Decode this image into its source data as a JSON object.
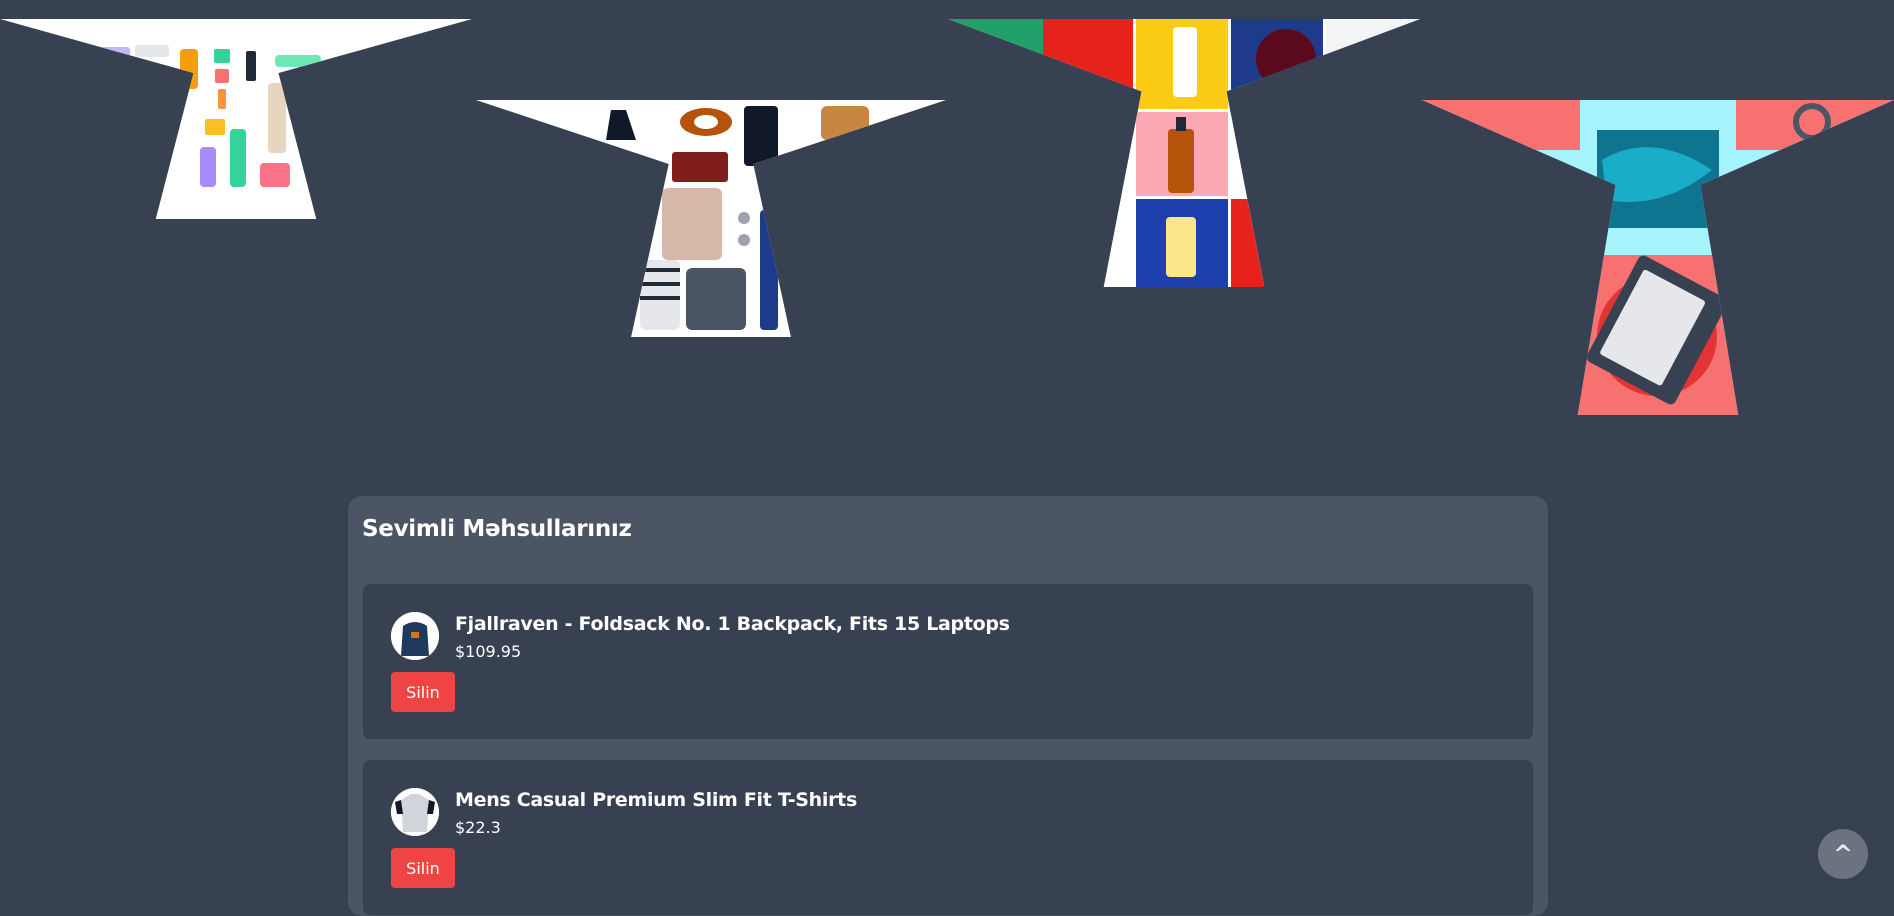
{
  "banners": [
    {
      "name": "cosmetics",
      "accent": "#f97316"
    },
    {
      "name": "fashion",
      "accent": "#7f1d1d"
    },
    {
      "name": "skincare",
      "accent": "#e5231b"
    },
    {
      "name": "electronics",
      "accent": "#f87171"
    }
  ],
  "favorites": {
    "heading": "Sevimli Məhsullarınız",
    "items": [
      {
        "title": "Fjallraven - Foldsack No. 1 Backpack, Fits 15 Laptops",
        "price": "$109.95",
        "remove_label": "Silin"
      },
      {
        "title": "Mens Casual Premium Slim Fit T-Shirts",
        "price": "$22.3",
        "remove_label": "Silin"
      }
    ]
  },
  "scroll_top": {
    "label": "^"
  },
  "colors": {
    "background": "#374151",
    "panel": "#4b5563",
    "card": "#374151",
    "danger": "#ef4444"
  }
}
